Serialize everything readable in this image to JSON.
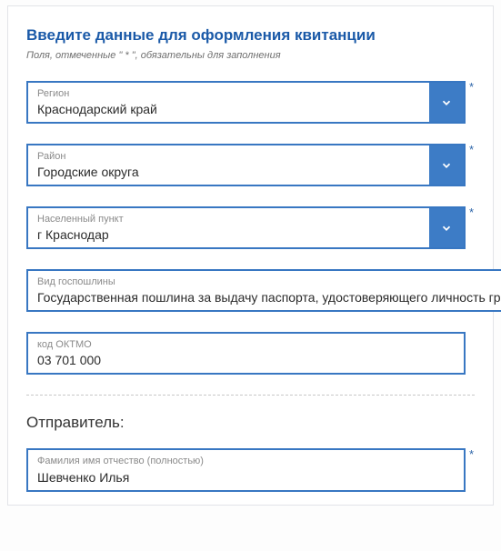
{
  "title": "Введите данные для оформления квитанции",
  "hint_prefix": "Поля, отмеченные ",
  "hint_mark": "\" * \"",
  "hint_suffix": ", обязательны для заполнения",
  "fields": {
    "region": {
      "label": "Регион",
      "value": "Краснодарский край",
      "required": "*"
    },
    "district": {
      "label": "Район",
      "value": "Городские округа",
      "required": "*"
    },
    "city": {
      "label": "Населенный пункт",
      "value": "г Краснодар",
      "required": "*"
    },
    "duty": {
      "label": "Вид госпошлины",
      "value": "Государственная пошлина за выдачу паспорта, удостоверяющего личность гражданина",
      "required": "*"
    },
    "oktmo": {
      "label": "код ОКТМО",
      "value": "03 701 000"
    }
  },
  "sender_title": "Отправитель:",
  "sender": {
    "fullname_label": "Фамилия имя отчество (полностью)",
    "fullname_value": "Шевченко Илья",
    "required": "*"
  }
}
